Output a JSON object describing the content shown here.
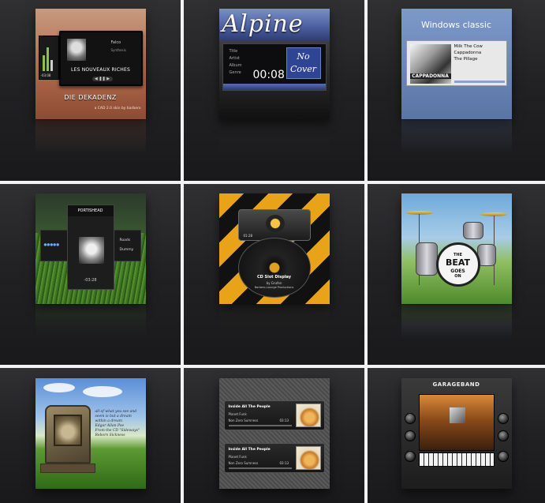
{
  "skins": [
    {
      "id": "die-dekadenz",
      "monitor_album": "LES NOUVEAUX RICHES",
      "monitor_artist": "Falco",
      "monitor_sub": "Synthesis",
      "side_time": "-03:08",
      "title": "DIE DEKADENZ",
      "subtitle": "a CAD 2.0 skin by barbero",
      "controls": "◀ ❚❚ ▶"
    },
    {
      "id": "alpine",
      "word": "Alpine",
      "labels": [
        "Title",
        "Artist",
        "Album",
        "Genre"
      ],
      "cover_line1": "No",
      "cover_line2": "Cover",
      "time": "00:08"
    },
    {
      "id": "windows-classic",
      "header": "Windows classic",
      "track": "Milk The Cow",
      "artist": "Cappadonna",
      "album": "The Pillage",
      "art_text": "CAPPADONNA"
    },
    {
      "id": "portishead",
      "band": "PORTISHEAD",
      "left_label": "●●●●●",
      "right_top": "Roads",
      "right_bottom": "Dummy",
      "time": "-03:28"
    },
    {
      "id": "cd-slot",
      "label": "CD Slot Display",
      "by": "by Grufen",
      "by2": "Barbero-Lounge Productions",
      "small_time": "01:28"
    },
    {
      "id": "beat-goes-on",
      "w1": "THE",
      "w2": "BEAT",
      "w3": "GOES",
      "w4": "ON"
    },
    {
      "id": "tombstone",
      "quote_lines": [
        "all of what you see and",
        "seem is but a dream",
        "within a dream",
        "Edgar Allan Poe",
        "From the CD \"Sideways\"",
        "Reborn Sickness"
      ]
    },
    {
      "id": "inside-all-the-people",
      "cards": [
        {
          "title": "Inside All The People",
          "artist": "Planet Funk",
          "album": "Non Zero Sumness",
          "time": "03:13"
        },
        {
          "title": "Inside All The People",
          "artist": "Planet Funk",
          "album": "Non Zero Sumness",
          "time": "03:13"
        }
      ]
    },
    {
      "id": "garageband",
      "title": "GARAGEBAND"
    }
  ]
}
